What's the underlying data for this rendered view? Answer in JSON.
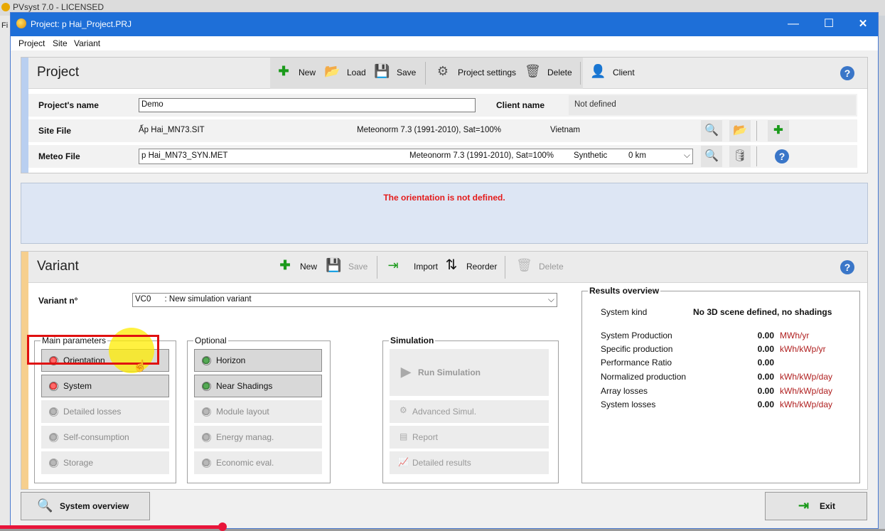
{
  "background": {
    "title": "PVsyst 7.0 - LICENSED",
    "left_menu": "Fi"
  },
  "window": {
    "title": "Project:  p Hai_Project.PRJ",
    "minimize": "—",
    "maximize": "☐",
    "close": "✕"
  },
  "menu": {
    "items": [
      "Project",
      "Site",
      "Variant"
    ]
  },
  "project": {
    "title": "Project",
    "toolbar": {
      "new": "New",
      "load": "Load",
      "save": "Save",
      "settings": "Project settings",
      "delete": "Delete",
      "client": "Client"
    },
    "help": "?",
    "name_label": "Project's name",
    "name_value": "Demo",
    "client_label": "Client name",
    "client_value": "Not defined",
    "site_label": "Site File",
    "site_file": "Ấp Hai_MN73.SIT",
    "site_source": "Meteonorm 7.3 (1991-2010), Sat=100%",
    "site_country": "Vietnam",
    "meteo_label": "Meteo File",
    "meteo_file": "p Hai_MN73_SYN.MET",
    "meteo_source": "Meteonorm 7.3 (1991-2010), Sat=100%",
    "meteo_type": "Synthetic",
    "meteo_distance": "0 km"
  },
  "message": "The orientation is not defined.",
  "variant": {
    "title": "Variant",
    "toolbar": {
      "new": "New",
      "save": "Save",
      "import": "Import",
      "reorder": "Reorder",
      "delete": "Delete"
    },
    "help": "?",
    "number_label": "Variant n°",
    "number_value": "VC0      : New simulation variant",
    "main_params": {
      "legend": "Main parameters",
      "buttons": [
        {
          "label": "Orientation",
          "status": "red"
        },
        {
          "label": "System",
          "status": "red"
        },
        {
          "label": "Detailed losses",
          "status": "gray"
        },
        {
          "label": "Self-consumption",
          "status": "gray"
        },
        {
          "label": "Storage",
          "status": "gray"
        }
      ]
    },
    "optional": {
      "legend": "Optional",
      "buttons": [
        {
          "label": "Horizon",
          "status": "green"
        },
        {
          "label": "Near Shadings",
          "status": "green"
        },
        {
          "label": "Module layout",
          "status": "gray"
        },
        {
          "label": "Energy manag.",
          "status": "gray"
        },
        {
          "label": "Economic eval.",
          "status": "gray"
        }
      ]
    },
    "simulation": {
      "legend": "Simulation",
      "run": "Run Simulation",
      "advanced": "Advanced Simul.",
      "report": "Report",
      "detailed": "Detailed results"
    },
    "results": {
      "legend": "Results overview",
      "system_kind_label": "System kind",
      "system_kind_value": "No 3D scene defined, no shadings",
      "rows": [
        {
          "label": "System Production",
          "value": "0.00",
          "unit": "MWh/yr"
        },
        {
          "label": "Specific production",
          "value": "0.00",
          "unit": "kWh/kWp/yr"
        },
        {
          "label": "Performance Ratio",
          "value": "0.00",
          "unit": ""
        },
        {
          "label": "Normalized production",
          "value": "0.00",
          "unit": "kWh/kWp/day"
        },
        {
          "label": "Array losses",
          "value": "0.00",
          "unit": "kWh/kWp/day"
        },
        {
          "label": "System losses",
          "value": "0.00",
          "unit": "kWh/kWp/day"
        }
      ]
    }
  },
  "footer": {
    "overview": "System overview",
    "exit": "Exit"
  },
  "colors": {
    "titlebar": "#1e6fd8",
    "project_stripe": "#b9cff0",
    "variant_stripe": "#f6cf8e",
    "error": "#e41b1b",
    "unit": "#b02020",
    "highlight": "#e01010"
  }
}
